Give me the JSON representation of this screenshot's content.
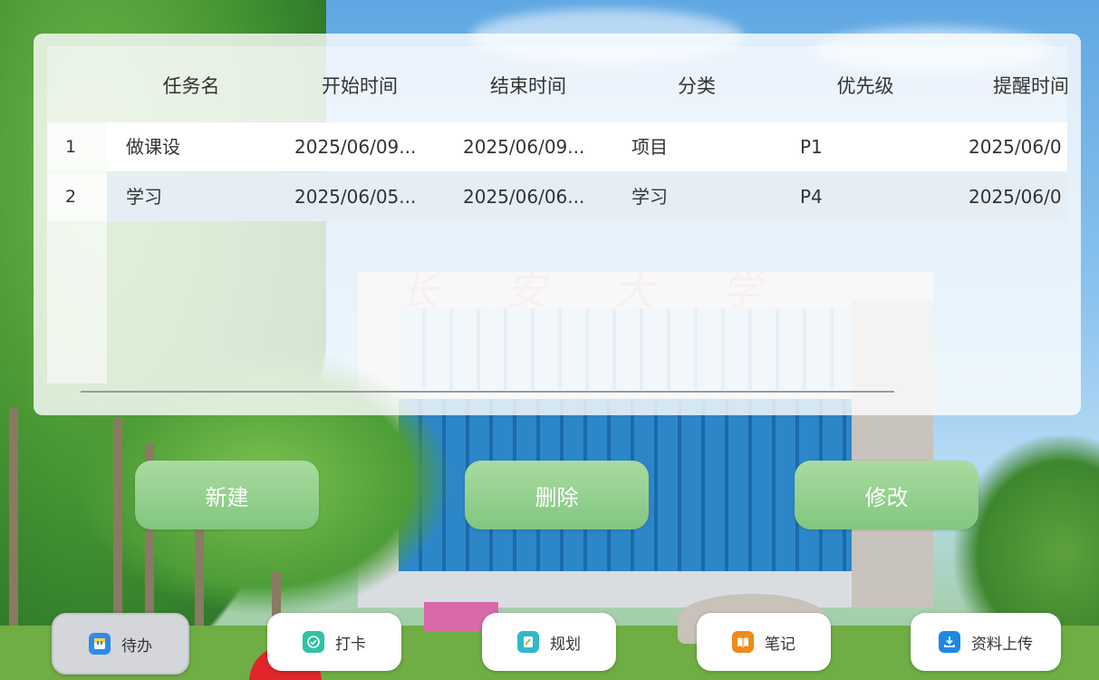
{
  "background": {
    "campus_name_chars": [
      "长",
      "安",
      "大",
      "学"
    ]
  },
  "table": {
    "headers": [
      "任务名",
      "开始时间",
      "结束时间",
      "分类",
      "优先级",
      "提醒时间"
    ],
    "rows": [
      {
        "num": "1",
        "cells": [
          "做课设",
          "2025/06/09...",
          "2025/06/09...",
          "项目",
          "P1",
          "2025/06/0"
        ]
      },
      {
        "num": "2",
        "cells": [
          "学习",
          "2025/06/05...",
          "2025/06/06...",
          "学习",
          "P4",
          "2025/06/0"
        ]
      }
    ]
  },
  "actions": {
    "new_label": "新建",
    "delete_label": "删除",
    "edit_label": "修改",
    "button_color": "#8fcd8a"
  },
  "tabs": [
    {
      "label": "待办",
      "icon": "todo-icon",
      "color": "#2b8cf0",
      "active": true
    },
    {
      "label": "打卡",
      "icon": "checkin-icon",
      "color": "#2ec4a3",
      "active": false
    },
    {
      "label": "规划",
      "icon": "plan-icon",
      "color": "#31b9c9",
      "active": false
    },
    {
      "label": "笔记",
      "icon": "notes-icon",
      "color": "#f08a1c",
      "active": false
    },
    {
      "label": "资料上传",
      "icon": "upload-icon",
      "color": "#1e88e5",
      "active": false
    }
  ]
}
